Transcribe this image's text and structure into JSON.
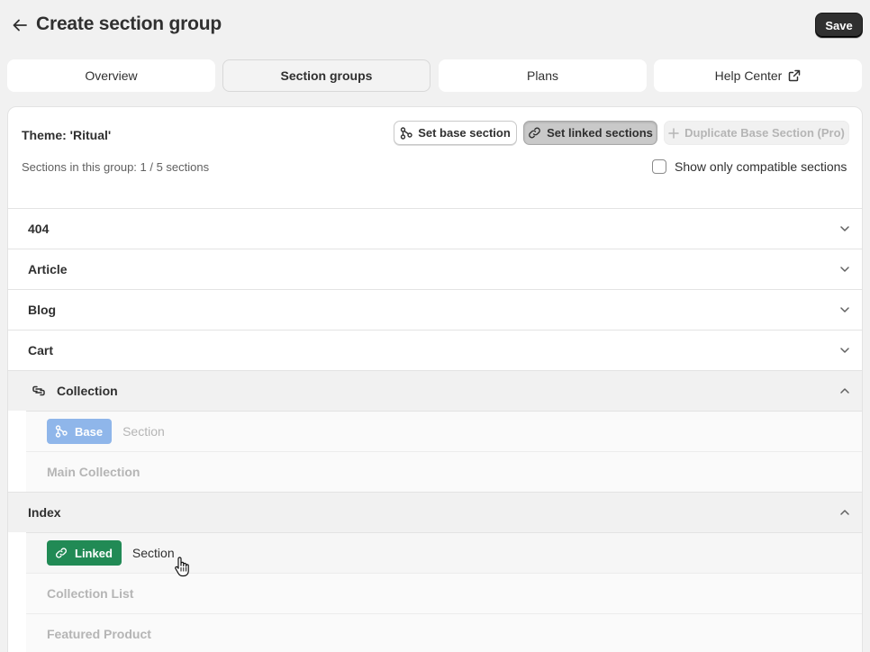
{
  "header": {
    "title": "Create section group",
    "save_label": "Save",
    "back_icon": "arrow-left-icon"
  },
  "tabs": [
    {
      "label": "Overview",
      "active": false
    },
    {
      "label": "Section groups",
      "active": true
    },
    {
      "label": "Plans",
      "active": false
    },
    {
      "label": "Help Center",
      "active": false,
      "icon": "external-link-icon"
    }
  ],
  "card": {
    "theme_title": "Theme: 'Ritual'",
    "group_count": "Sections in this group: 1 / 5 sections",
    "buttons": {
      "set_base": "Set base section",
      "set_linked": "Set linked sections",
      "duplicate": "Duplicate Base Section (Pro)"
    },
    "compatible_label": "Show only compatible sections",
    "compatible_checked": false
  },
  "templates": [
    {
      "name": "404",
      "expanded": false
    },
    {
      "name": "Article",
      "expanded": false
    },
    {
      "name": "Blog",
      "expanded": false
    },
    {
      "name": "Cart",
      "expanded": false
    },
    {
      "name": "Collection",
      "expanded": true,
      "icon": "group-link-icon",
      "header_badge": "Base",
      "header_label": "Section",
      "sections": [
        "Main Collection"
      ]
    },
    {
      "name": "Index",
      "expanded": true,
      "header_badge": "Linked",
      "header_label": "Section",
      "sections": [
        "Collection List",
        "Featured Product"
      ]
    }
  ],
  "colors": {
    "base_badge": "#8fb6ea",
    "linked_badge": "#218a55",
    "save_button": "#303030"
  }
}
